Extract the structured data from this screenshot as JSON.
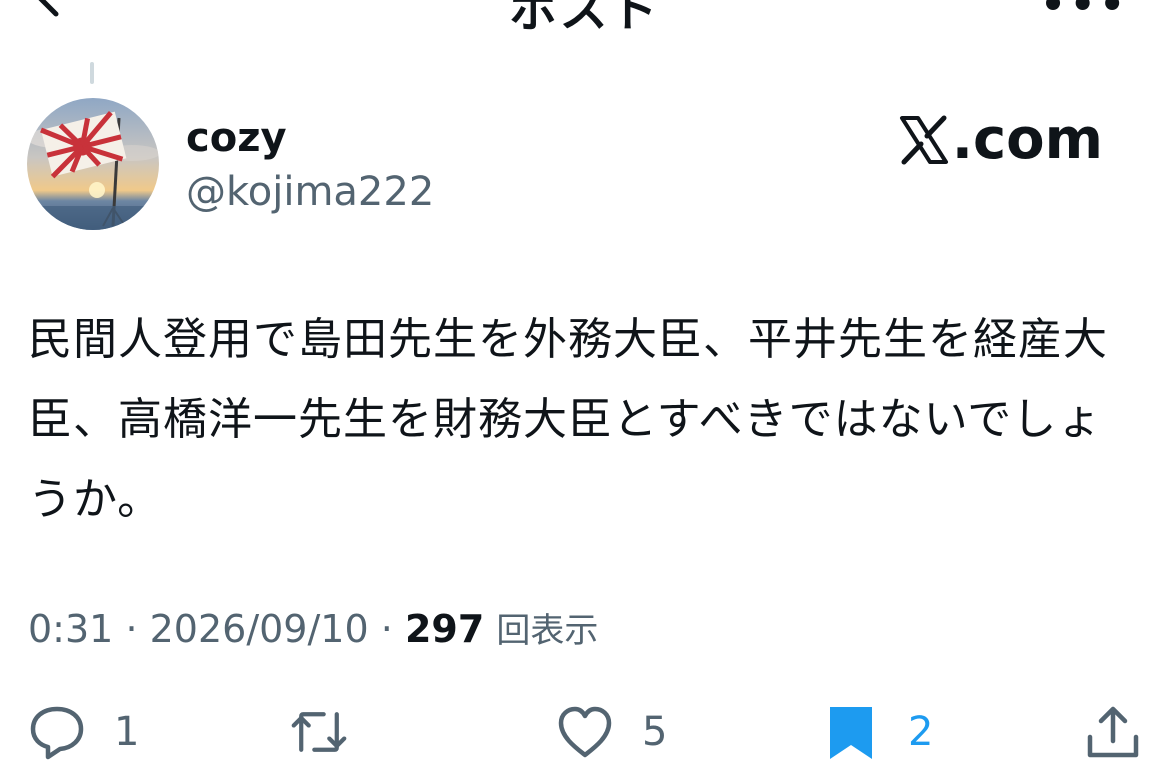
{
  "nav": {
    "title": "ポスト"
  },
  "author": {
    "display_name": "cozy",
    "handle": "@kojima222"
  },
  "watermark": {
    "text": ".com"
  },
  "post": {
    "text": "民間人登用で島田先生を外務大臣、平井先生を経産大臣、高橋洋一先生を財務大臣とすべきではないでしょうか。"
  },
  "meta": {
    "time": "0:31",
    "date": "2026/09/10",
    "sep": "·",
    "views_count": "297",
    "views_label": "回表示"
  },
  "actions": {
    "reply_count": "1",
    "like_count": "5",
    "bookmark_count": "2"
  },
  "colors": {
    "text": "#0f1419",
    "secondary": "#536471",
    "accent": "#1d9bf0"
  },
  "icons": [
    "back-arrow-icon",
    "more-icon",
    "x-logo-icon",
    "reply-icon",
    "repost-icon",
    "like-icon",
    "bookmark-icon",
    "share-icon"
  ]
}
